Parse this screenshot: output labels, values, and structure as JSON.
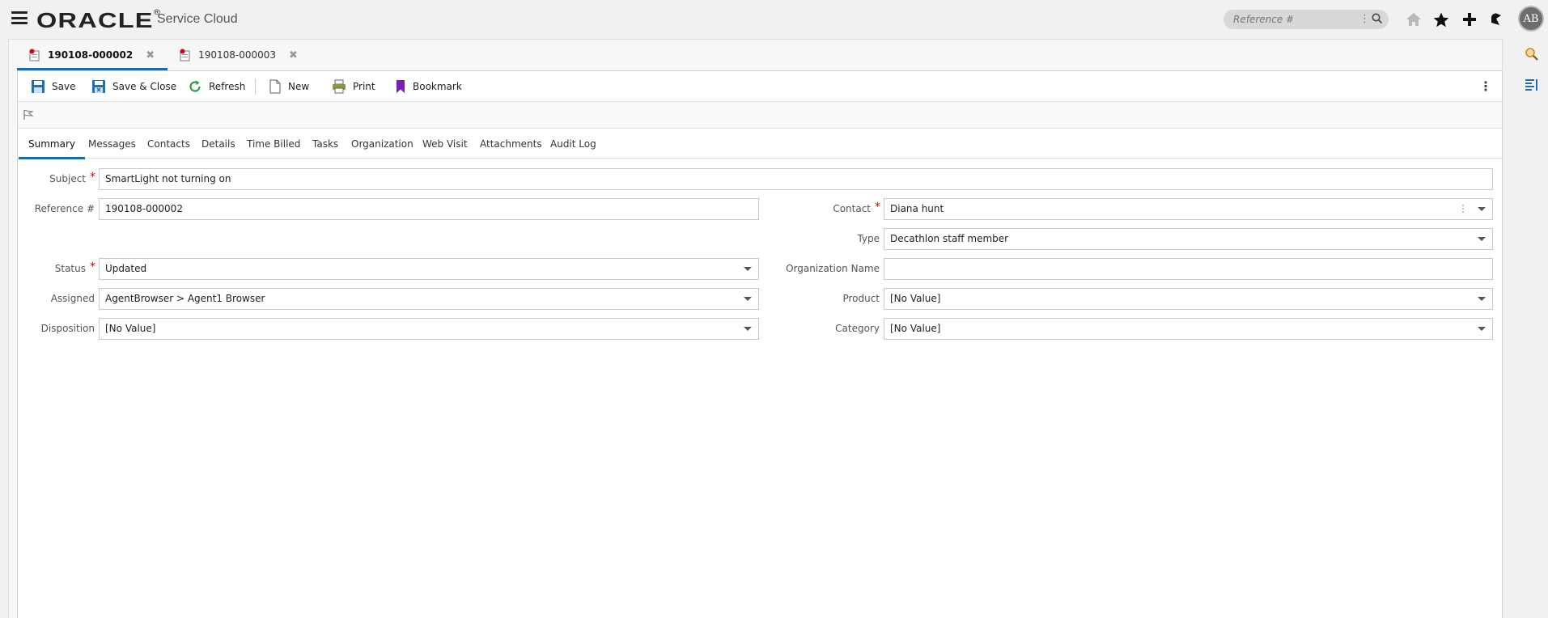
{
  "app": {
    "logo_text": "ORACLE",
    "logo_mark": "®",
    "product_name": "Service Cloud"
  },
  "header": {
    "search_placeholder": "Reference #",
    "icons": [
      "home-icon",
      "star-icon",
      "plus-icon",
      "notification-icon"
    ],
    "avatar_initials": "AB"
  },
  "doc_tabs": [
    {
      "label": "190108-000002",
      "active": true
    },
    {
      "label": "190108-000003",
      "active": false
    }
  ],
  "toolbar": {
    "save": "Save",
    "save_close": "Save & Close",
    "refresh": "Refresh",
    "new": "New",
    "print": "Print",
    "bookmark": "Bookmark"
  },
  "subtabs": [
    "Summary",
    "Messages",
    "Contacts",
    "Details",
    "Time Billed",
    "Tasks",
    "Organization",
    "Web Visit",
    "Attachments",
    "Audit Log"
  ],
  "active_subtab": "Summary",
  "form": {
    "subject": {
      "label": "Subject",
      "value": "SmartLight not turning on",
      "required": true
    },
    "reference": {
      "label": "Reference #",
      "value": "190108-000002"
    },
    "status": {
      "label": "Status",
      "value": "Updated",
      "required": true
    },
    "assigned": {
      "label": "Assigned",
      "value": "AgentBrowser > Agent1 Browser"
    },
    "disposition": {
      "label": "Disposition",
      "value": "[No Value]"
    },
    "contact": {
      "label": "Contact",
      "value": "Diana hunt",
      "required": true
    },
    "type": {
      "label": "Type",
      "value": "Decathlon staff member"
    },
    "organization_name": {
      "label": "Organization Name",
      "value": ""
    },
    "product": {
      "label": "Product",
      "value": "[No Value]"
    },
    "category": {
      "label": "Category",
      "value": "[No Value]"
    }
  },
  "colors": {
    "accent": "#0d6fb8",
    "required": "#d9001b",
    "refresh_green": "#2e9e3e",
    "bookmark_purple": "#7a1fb4"
  }
}
